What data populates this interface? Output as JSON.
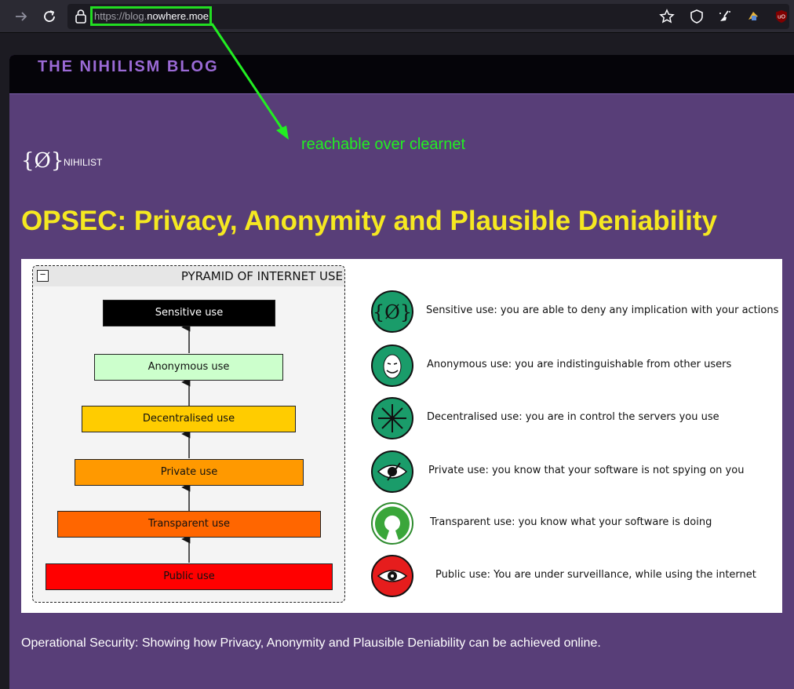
{
  "browser": {
    "url_prefix": "https://blog.",
    "url_host": "nowhere.moe",
    "back_icon": "arrow-right-icon",
    "reload_icon": "reload-icon"
  },
  "annotation": {
    "label": "reachable over clearnet",
    "color": "#22ee22"
  },
  "site": {
    "title": "THE NIHILISM BLOG",
    "logo_text": "{Ø}",
    "logo_label": "NIHILIST"
  },
  "post": {
    "title": "OPSEC: Privacy, Anonymity and Plausible Deniability",
    "caption": "Operational Security: Showing how Privacy, Anonymity and Plausible Deniability can be achieved online."
  },
  "pyramid": {
    "title": "PYRAMID OF INTERNET USE",
    "collapse_symbol": "−",
    "levels": [
      {
        "label": "Sensitive use",
        "color": "#000000"
      },
      {
        "label": "Anonymous use",
        "color": "#ccffcc"
      },
      {
        "label": "Decentralised use",
        "color": "#ffcc00"
      },
      {
        "label": "Private use",
        "color": "#ff9900"
      },
      {
        "label": "Transparent use",
        "color": "#ff6600"
      },
      {
        "label": "Public use",
        "color": "#ff0000"
      }
    ]
  },
  "legend": [
    {
      "icon": "nihilist-logo-icon",
      "text": "Sensitive use: you are able to deny any implication with your actions"
    },
    {
      "icon": "guy-fawkes-mask-icon",
      "text": "Anonymous use: you are indistinguishable from other users"
    },
    {
      "icon": "decentralised-network-icon",
      "text": "Decentralised use: you are in control the servers you use"
    },
    {
      "icon": "eye-slashed-icon",
      "text": "Private use: you know that your software is not spying on you"
    },
    {
      "icon": "open-source-icon",
      "text": "Transparent use: you know what your software is doing"
    },
    {
      "icon": "surveillance-eye-icon",
      "text": "Public use: You are under surveillance, while using the internet"
    }
  ],
  "colors": {
    "page_bg": "#583e78",
    "header_bg": "#050409",
    "title_purple": "#9b6ad6",
    "heading_yellow": "#f5e821",
    "icon_green": "#1a9c6a",
    "icon_red": "#e61d1d"
  }
}
